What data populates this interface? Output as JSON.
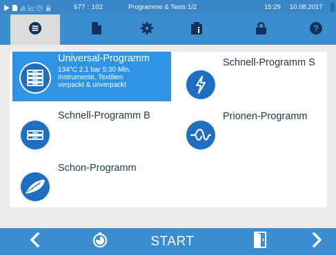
{
  "statusbar": {
    "icons": [
      "play-icon",
      "document-icon",
      "antenna-icon",
      "graph-icon",
      "clock-icon",
      "lock-icon"
    ],
    "counter": "677 : 102",
    "title": "Programme & Tests  1/2",
    "time": "15:29",
    "date": "10.08.2017"
  },
  "tabs": [
    {
      "name": "program-list",
      "icon": "list-icon",
      "active": true
    },
    {
      "name": "document",
      "icon": "document-icon",
      "active": false
    },
    {
      "name": "settings",
      "icon": "gear-icon",
      "active": false
    },
    {
      "name": "info",
      "icon": "info-book-icon",
      "active": false
    },
    {
      "name": "lock",
      "icon": "lock-icon",
      "active": false
    },
    {
      "name": "help",
      "icon": "help-icon",
      "active": false
    }
  ],
  "programs": [
    {
      "title": "Universal-Programm",
      "selected": true,
      "icon": "trays-icon",
      "details": [
        "134°C  2.1 bar  5:30 Min.",
        "Instrumente, Textilien",
        "verpackt & unverpackt"
      ]
    },
    {
      "title": "Schnell-Programm S",
      "selected": false,
      "icon": "lightning-icon"
    },
    {
      "title": "Schnell-Programm B",
      "selected": false,
      "icon": "single-tray-icon"
    },
    {
      "title": "Prionen-Programm",
      "selected": false,
      "icon": "prion-icon"
    },
    {
      "title": "Schon-Programm",
      "selected": false,
      "icon": "feather-icon"
    }
  ],
  "bottombar": {
    "start_label": "START",
    "icons": [
      "chevron-left-icon",
      "timer-icon",
      "door-icon",
      "chevron-right-icon"
    ]
  },
  "colors": {
    "bar_blue": "#3a8ed0",
    "selected_blue": "#2f94e6",
    "icon_blue": "#1e6fbf",
    "title_text": "#1f3550"
  }
}
